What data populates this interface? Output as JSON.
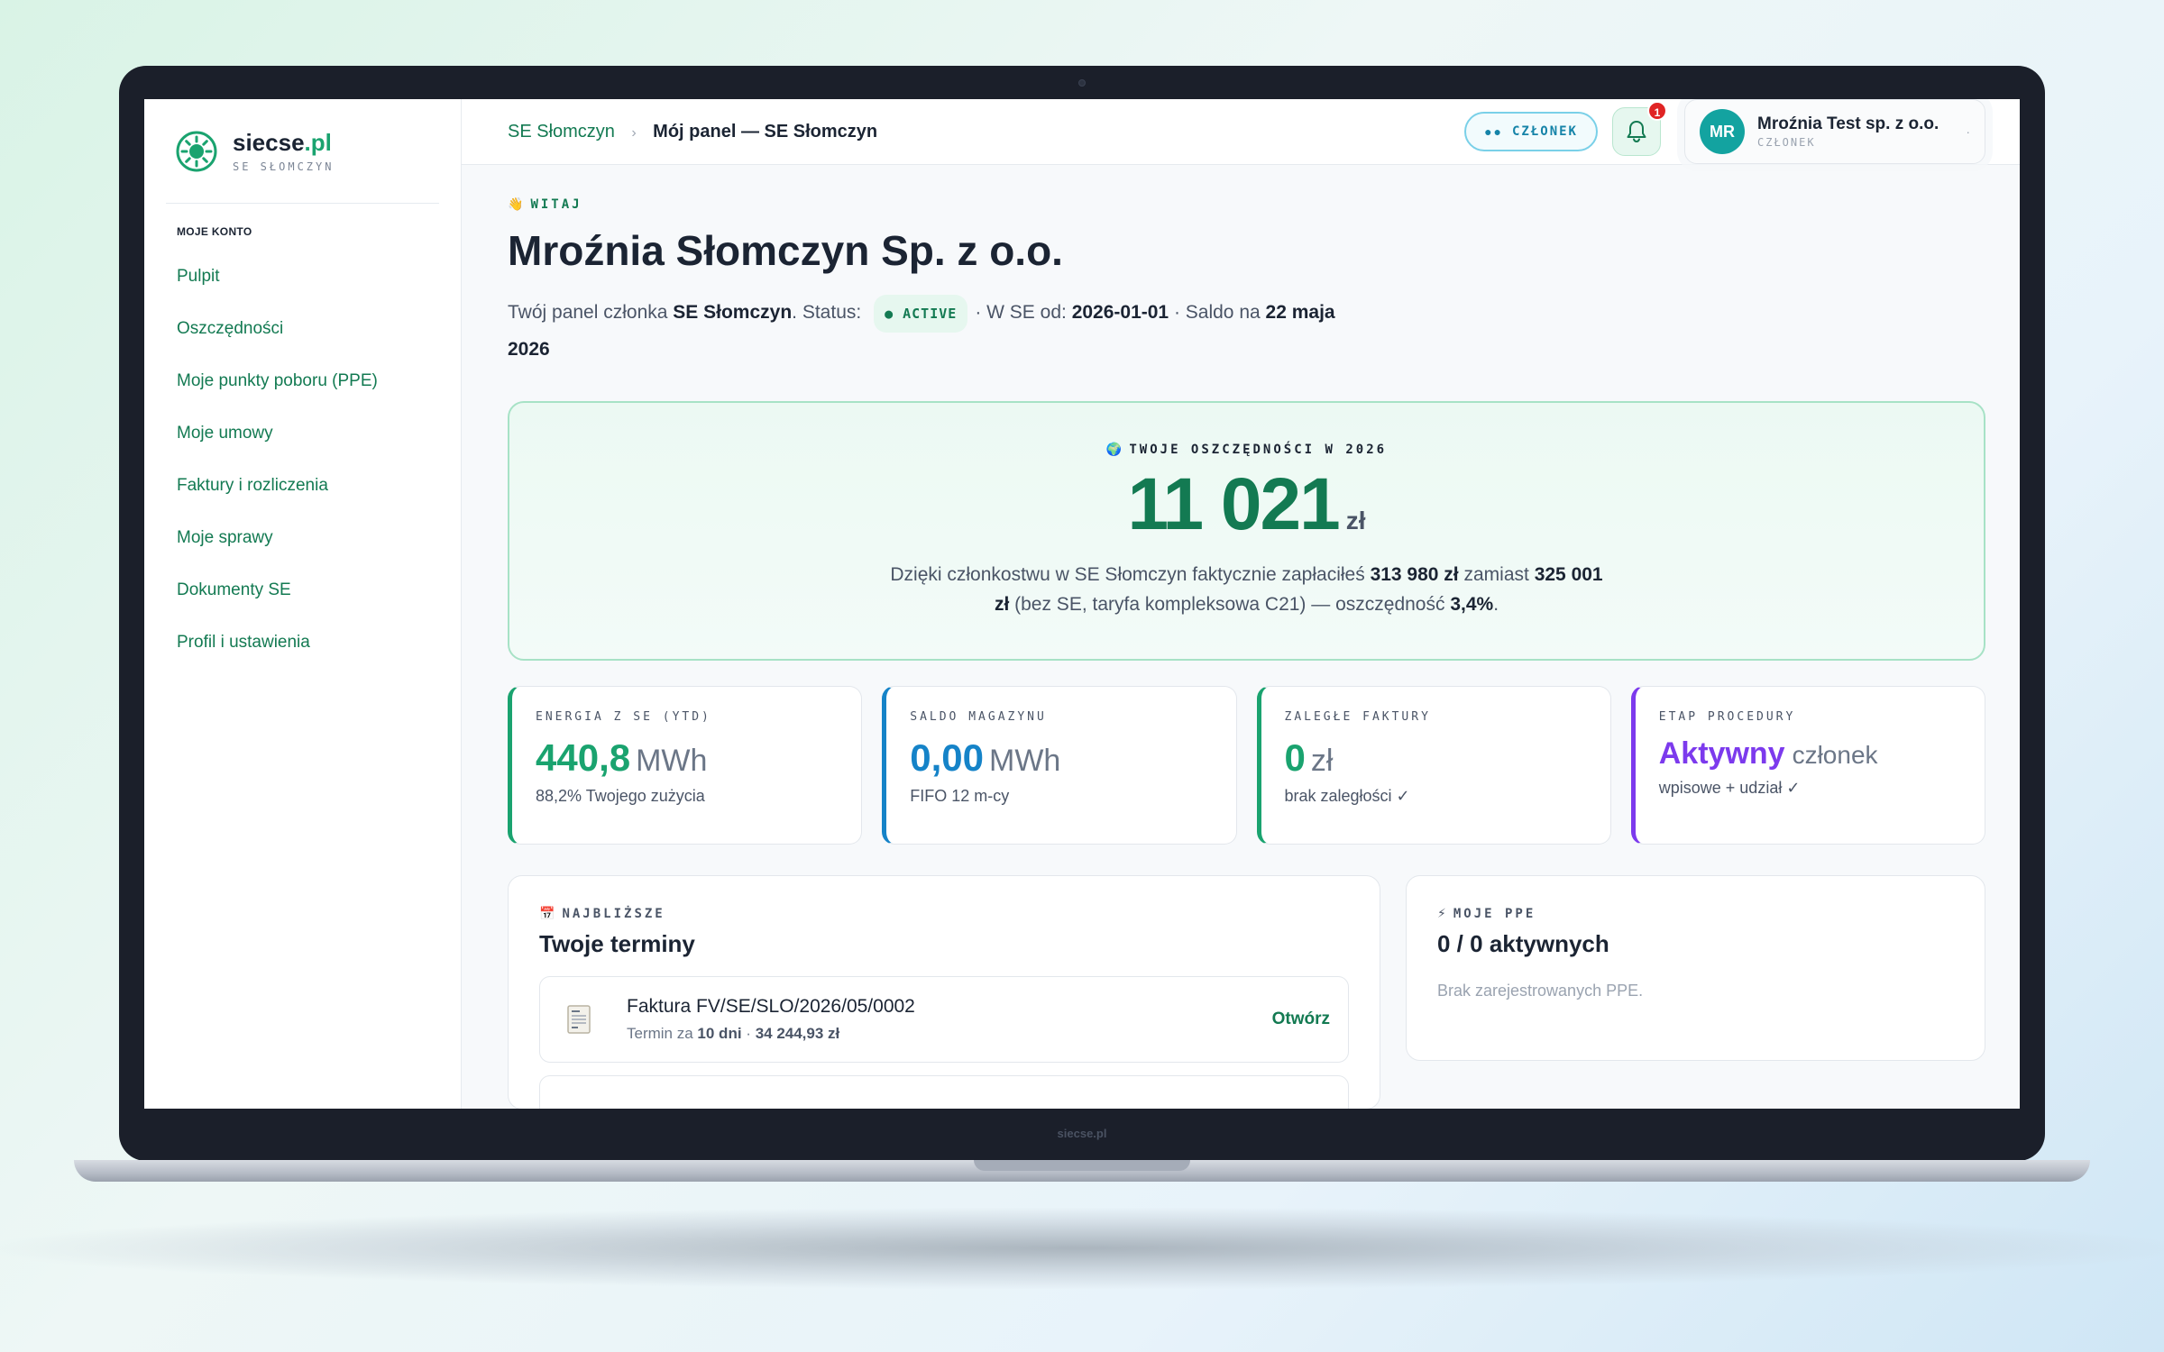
{
  "brand": {
    "name": "siecse",
    "tld": ".pl",
    "subtitle": "SE SŁOMCZYN",
    "bezel_label": "siecse.pl"
  },
  "sidebar": {
    "section_label": "MOJE KONTO",
    "items": [
      {
        "label": "Pulpit"
      },
      {
        "label": "Oszczędności"
      },
      {
        "label": "Moje punkty poboru (PPE)"
      },
      {
        "label": "Moje umowy"
      },
      {
        "label": "Faktury i rozliczenia"
      },
      {
        "label": "Moje sprawy"
      },
      {
        "label": "Dokumenty SE"
      },
      {
        "label": "Profil i ustawienia"
      }
    ]
  },
  "header": {
    "breadcrumb_root": "SE Słomczyn",
    "breadcrumb_sep": "›",
    "breadcrumb_current": "Mój panel — SE Słomczyn",
    "role_pill_dots": "●●",
    "role_pill": "CZŁONEK",
    "notifications_count": "1",
    "user": {
      "initials": "MR",
      "name": "Mroźnia Test sp. z o.o.",
      "role": "CZŁONEK",
      "caret": "·"
    }
  },
  "welcome": {
    "eyebrow_icon": "👋",
    "eyebrow": "WITAJ",
    "title": "Mroźnia Słomczyn Sp. z o.o.",
    "intro_prefix": "Twój panel członka",
    "se_name": "SE Słomczyn",
    "status_label": ". Status:",
    "status_value": "● ACTIVE",
    "since_label": "· W SE od:",
    "since_value": "2026-01-01",
    "balance_label": "· Saldo na",
    "balance_date": "22 maja 2026"
  },
  "savings": {
    "eyebrow_icon": "🌍",
    "eyebrow": "TWOJE OSZCZĘDNOŚCI W 2026",
    "amount": "11 021",
    "unit": "zł",
    "desc_1": "Dzięki członkostwu w SE Słomczyn faktycznie zapłaciłeś",
    "paid": "313 980 zł",
    "desc_2": "zamiast",
    "without_se": "325 001 zł",
    "desc_3": "(bez SE, taryfa kompleksowa C21) — oszczędność",
    "percent": "3,4%",
    "desc_4": "."
  },
  "kpis": [
    {
      "label": "ENERGIA Z SE (YTD)",
      "value": "440,8",
      "unit": "MWh",
      "sub": "88,2% Twojego zużycia",
      "color": "#1aa36f"
    },
    {
      "label": "SALDO MAGAZYNU",
      "value": "0,00",
      "unit": "MWh",
      "sub": "FIFO 12 m-cy",
      "color": "#1583c8"
    },
    {
      "label": "ZALEGŁE FAKTURY",
      "value": "0",
      "unit": "zł",
      "sub": "brak zaległości ✓",
      "color": "#1aa36f"
    },
    {
      "label": "ETAP PROCEDURY",
      "value": "Aktywny",
      "unit": "członek",
      "sub": "wpisowe + udział ✓",
      "color": "#7c3aed"
    }
  ],
  "deadlines": {
    "eyebrow_icon": "📅",
    "eyebrow": "NAJBLIŻSZE",
    "title": "Twoje terminy",
    "items": [
      {
        "title": "Faktura FV/SE/SLO/2026/05/0002",
        "due_prefix": "Termin za",
        "due": "10 dni",
        "sep": "·",
        "amount": "34 244,93 zł",
        "action": "Otwórz"
      }
    ]
  },
  "ppe": {
    "eyebrow_icon": "⚡",
    "eyebrow": "MOJE PPE",
    "title": "0 / 0 aktywnych",
    "empty": "Brak zarejestrowanych PPE."
  }
}
